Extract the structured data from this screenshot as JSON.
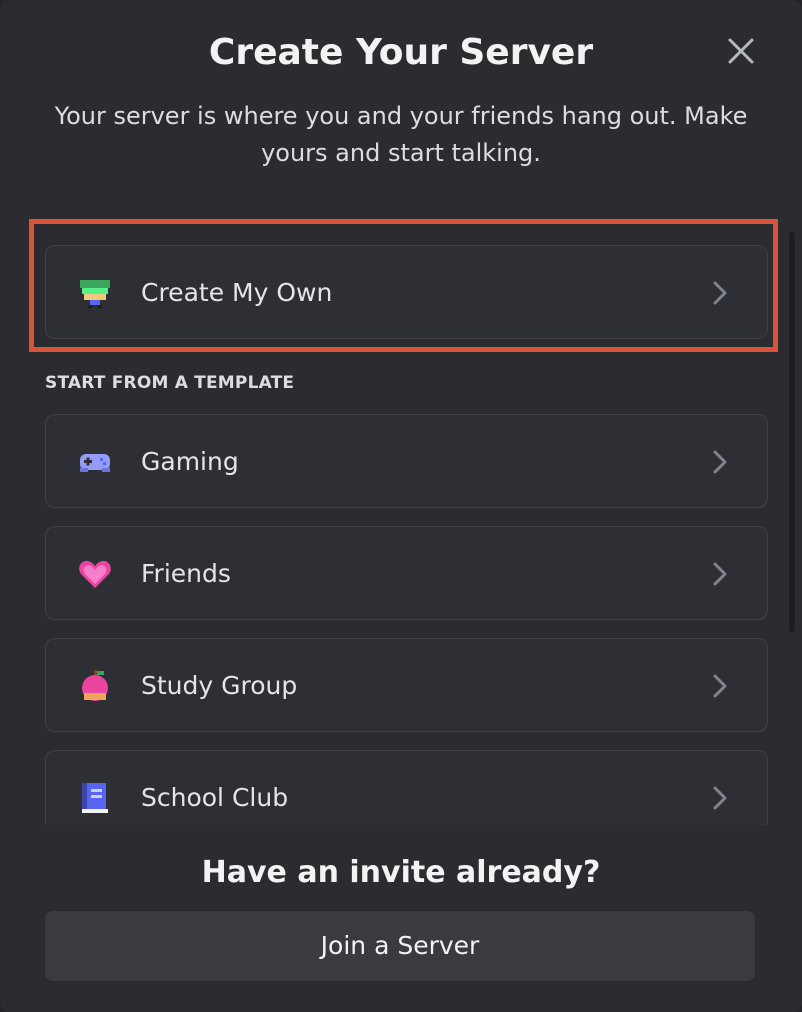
{
  "modal": {
    "title": "Create Your Server",
    "subtitle": "Your server is where you and your friends hang out. Make yours and start talking.",
    "close_icon": "close-icon"
  },
  "create_own": {
    "label": "Create My Own",
    "icon": "create-own-icon"
  },
  "templates": {
    "section_label": "START FROM A TEMPLATE",
    "items": [
      {
        "label": "Gaming",
        "icon": "gamepad-icon"
      },
      {
        "label": "Friends",
        "icon": "heart-icon"
      },
      {
        "label": "Study Group",
        "icon": "apple-icon"
      },
      {
        "label": "School Club",
        "icon": "book-icon"
      }
    ]
  },
  "footer": {
    "title": "Have an invite already?",
    "join_label": "Join a Server"
  },
  "colors": {
    "highlight": "#d9533d",
    "background": "#2b2b30",
    "card": "#2e2f34"
  }
}
